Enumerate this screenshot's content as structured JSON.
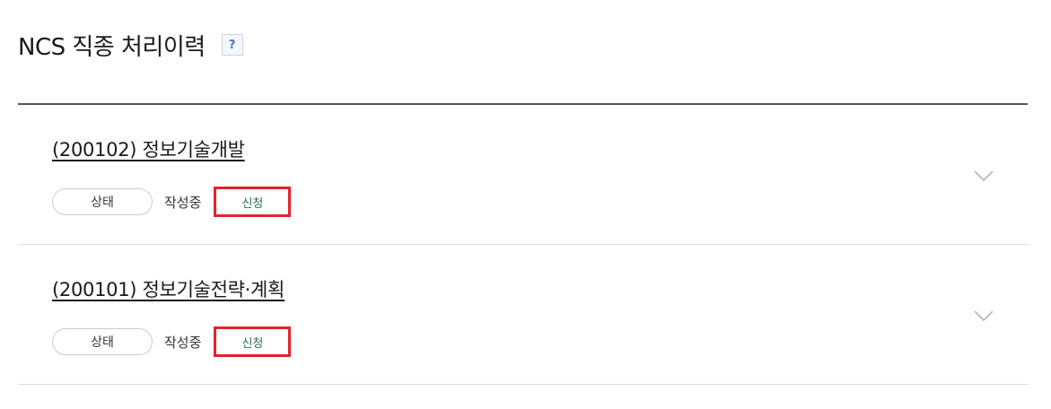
{
  "header": {
    "title": "NCS 직종 처리이력",
    "help_label": "?"
  },
  "items": [
    {
      "title": "(200102) 정보기술개발",
      "status_label": "상태",
      "status_value": "작성중",
      "action_label": "신청"
    },
    {
      "title": "(200101) 정보기술전략·계획",
      "status_label": "상태",
      "status_value": "작성중",
      "action_label": "신청"
    }
  ],
  "icons": {
    "help": "question-icon",
    "expand": "chevron-down-icon"
  },
  "colors": {
    "highlight_border": "#e0242c",
    "action_text": "#2b6b5a",
    "help_text": "#4a6fd0"
  }
}
